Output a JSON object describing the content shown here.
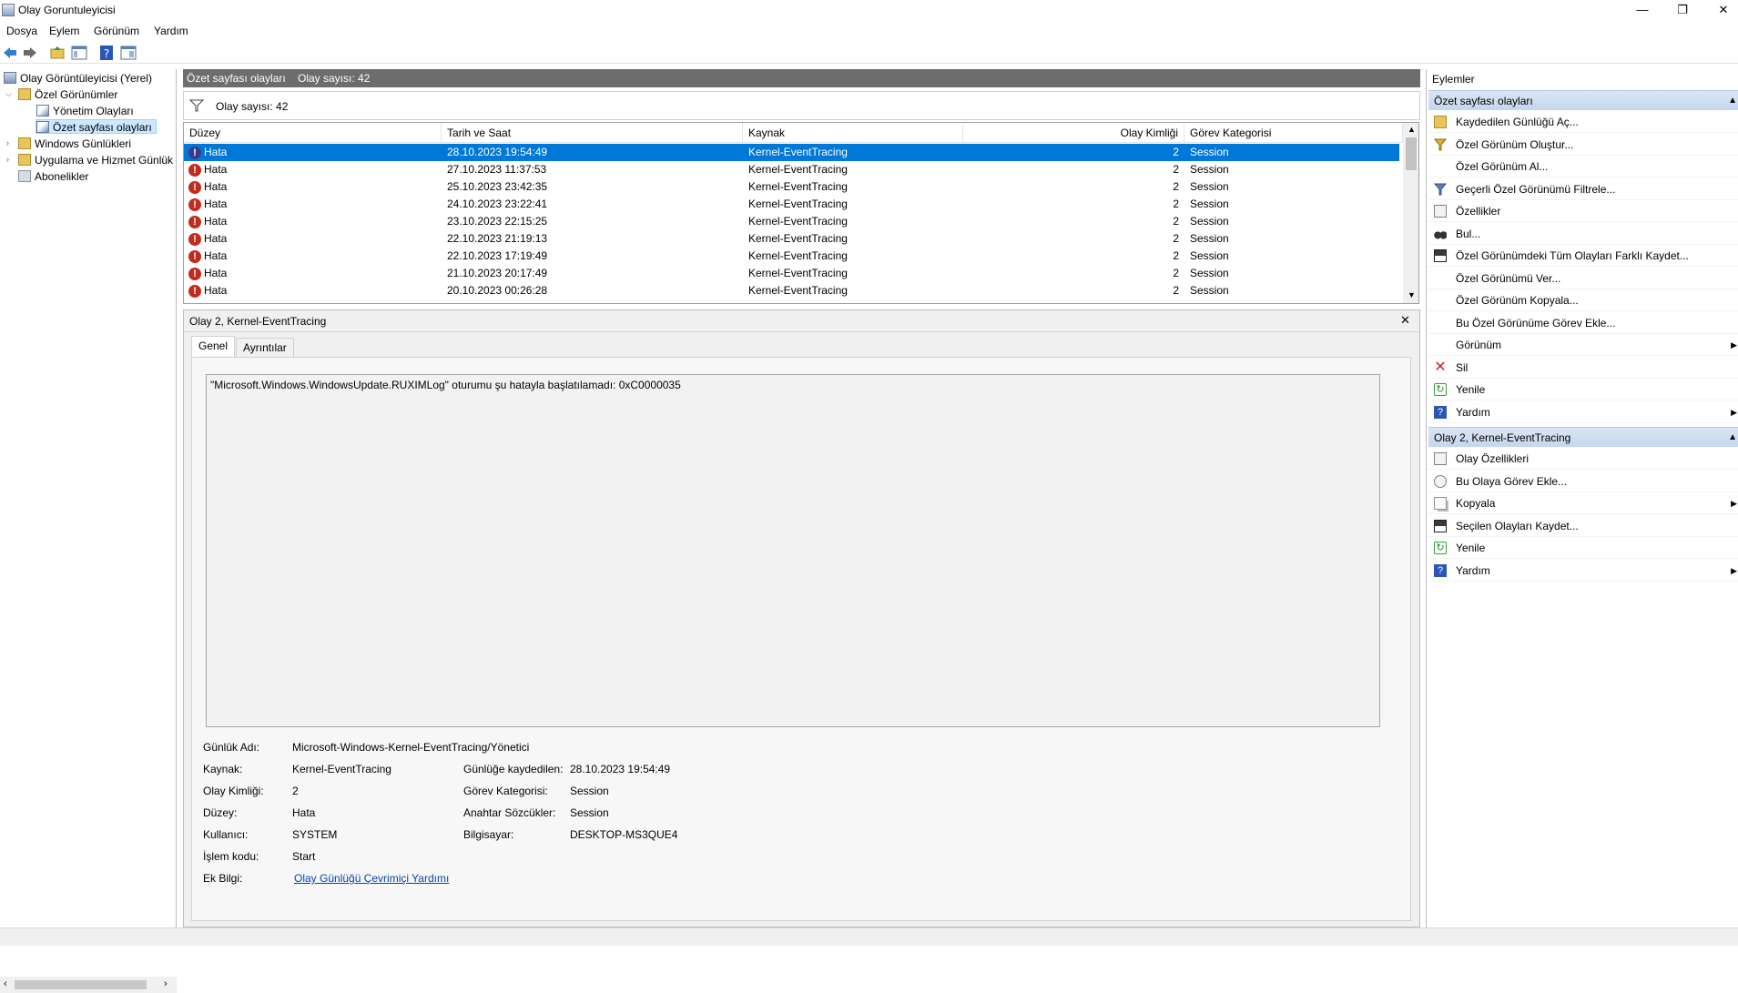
{
  "window": {
    "title": "Olay Goruntuleyicisi",
    "minimize": "—",
    "restore": "❐",
    "close": "✕"
  },
  "menu": [
    "Dosya",
    "Eylem",
    "Görünüm",
    "Yardım"
  ],
  "tree": {
    "root": "Olay Görüntüleyicisi (Yerel)",
    "custom_views": "Özel Görünümler",
    "admin_events": "Yönetim Olayları",
    "summary_events": "Özet sayfası olayları",
    "windows_logs": "Windows Günlükleri",
    "app_service_logs": "Uygulama ve Hizmet Günlük",
    "subscriptions": "Abonelikler"
  },
  "center": {
    "header_title": "Özet sayfası olayları",
    "header_count": "Olay sayısı: 42",
    "filter_text": "Olay sayısı: 42",
    "columns": [
      "Düzey",
      "Tarih ve Saat",
      "Kaynak",
      "Olay Kimliği",
      "Görev Kategorisi"
    ],
    "rows": [
      {
        "level": "Hata",
        "date": "28.10.2023 19:54:49",
        "source": "Kernel-EventTracing",
        "id": "2",
        "category": "Session"
      },
      {
        "level": "Hata",
        "date": "27.10.2023 11:37:53",
        "source": "Kernel-EventTracing",
        "id": "2",
        "category": "Session"
      },
      {
        "level": "Hata",
        "date": "25.10.2023 23:42:35",
        "source": "Kernel-EventTracing",
        "id": "2",
        "category": "Session"
      },
      {
        "level": "Hata",
        "date": "24.10.2023 23:22:41",
        "source": "Kernel-EventTracing",
        "id": "2",
        "category": "Session"
      },
      {
        "level": "Hata",
        "date": "23.10.2023 22:15:25",
        "source": "Kernel-EventTracing",
        "id": "2",
        "category": "Session"
      },
      {
        "level": "Hata",
        "date": "22.10.2023 21:19:13",
        "source": "Kernel-EventTracing",
        "id": "2",
        "category": "Session"
      },
      {
        "level": "Hata",
        "date": "22.10.2023 17:19:49",
        "source": "Kernel-EventTracing",
        "id": "2",
        "category": "Session"
      },
      {
        "level": "Hata",
        "date": "21.10.2023 20:17:49",
        "source": "Kernel-EventTracing",
        "id": "2",
        "category": "Session"
      },
      {
        "level": "Hata",
        "date": "20.10.2023 00:26:28",
        "source": "Kernel-EventTracing",
        "id": "2",
        "category": "Session"
      }
    ]
  },
  "detail": {
    "title": "Olay 2, Kernel-EventTracing",
    "close": "✕",
    "tabs": [
      "Genel",
      "Ayrıntılar"
    ],
    "description": "\"Microsoft.Windows.WindowsUpdate.RUXIMLog\" oturumu şu hatayla başlatılamadı: 0xC0000035",
    "fields": {
      "log_name_label": "Günlük Adı:",
      "log_name": "Microsoft-Windows-Kernel-EventTracing/Yönetici",
      "source_label": "Kaynak:",
      "source": "Kernel-EventTracing",
      "logged_label": "Günlüğe kaydedilen:",
      "logged": "28.10.2023 19:54:49",
      "event_id_label": "Olay Kimliği:",
      "event_id": "2",
      "task_label": "Görev Kategorisi:",
      "task": "Session",
      "level_label": "Düzey:",
      "level": "Hata",
      "keywords_label": "Anahtar Sözcükler:",
      "keywords": "Session",
      "user_label": "Kullanıcı:",
      "user": "SYSTEM",
      "computer_label": "Bilgisayar:",
      "computer": "DESKTOP-MS3QUE4",
      "opcode_label": "İşlem kodu:",
      "opcode": "Start",
      "more_info_label": "Ek Bilgi:",
      "more_info_link": "Olay Günlüğü Çevrimiçi Yardımı"
    }
  },
  "actions": {
    "title": "Eylemler",
    "section1": "Özet sayfası olayları",
    "items1": [
      {
        "label": "Kaydedilen Günlüğü Aç...",
        "icon": "folder-open-icon"
      },
      {
        "label": "Özel Görünüm Oluştur...",
        "icon": "filter-create-icon"
      },
      {
        "label": "Özel Görünüm Al...",
        "icon": "none"
      },
      {
        "label": "Geçerli Özel Görünümü Filtrele...",
        "icon": "filter-icon"
      },
      {
        "label": "Özellikler",
        "icon": "properties-icon"
      },
      {
        "label": "Bul...",
        "icon": "binoculars-icon"
      },
      {
        "label": "Özel Görünümdeki Tüm Olayları Farklı Kaydet...",
        "icon": "save-icon"
      },
      {
        "label": "Özel Görünümü Ver...",
        "icon": "none"
      },
      {
        "label": "Özel Görünüm Kopyala...",
        "icon": "none"
      },
      {
        "label": "Bu Özel Görünüme Görev Ekle...",
        "icon": "none"
      },
      {
        "label": "Görünüm",
        "icon": "none"
      },
      {
        "label": "Sil",
        "icon": "delete-icon"
      },
      {
        "label": "Yenile",
        "icon": "refresh-icon"
      },
      {
        "label": "Yardım",
        "icon": "help-icon"
      }
    ],
    "section2": "Olay 2, Kernel-EventTracing",
    "items2": [
      {
        "label": "Olay Özellikleri",
        "icon": "properties-icon"
      },
      {
        "label": "Bu Olaya Görev Ekle...",
        "icon": "task-icon"
      },
      {
        "label": "Kopyala",
        "icon": "copy-icon"
      },
      {
        "label": "Seçilen Olayları Kaydet...",
        "icon": "save-icon"
      },
      {
        "label": "Yenile",
        "icon": "refresh-icon"
      },
      {
        "label": "Yardım",
        "icon": "help-icon"
      }
    ]
  },
  "colors": {
    "selection": "#0078d7",
    "error": "#c42b1c",
    "header_gray": "#6d6d6d",
    "link": "#0645ad"
  }
}
